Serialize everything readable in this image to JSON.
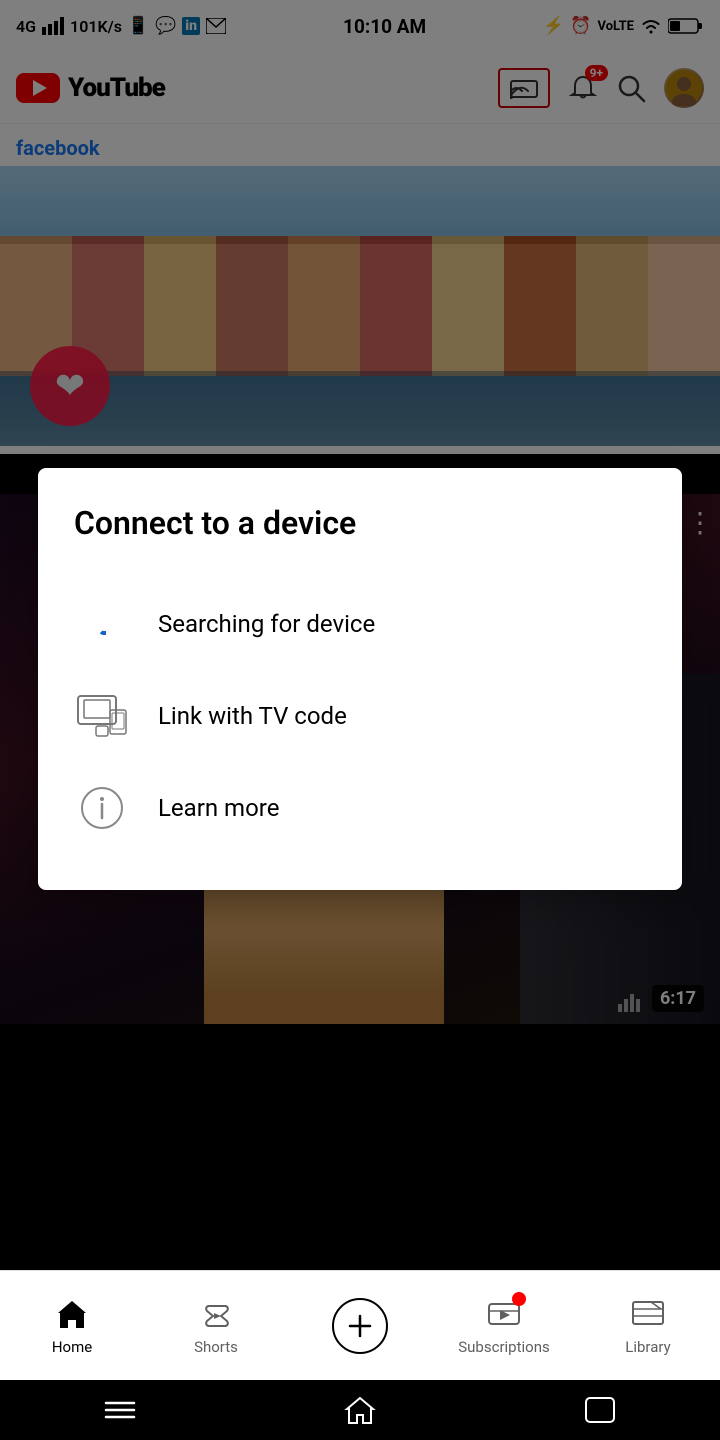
{
  "statusBar": {
    "signal": "4G",
    "bars": "▌▌▌",
    "speed": "101K/s",
    "time": "10:10 AM",
    "battery": "34"
  },
  "header": {
    "logoText": "YouTube",
    "castLabel": "cast-icon",
    "notifBadge": "9+",
    "searchLabel": "search-icon",
    "avatarLabel": "user-avatar"
  },
  "fbPost": {
    "source": "facebook",
    "label": "facebook"
  },
  "secondVideo": {
    "duration": "6:17"
  },
  "modal": {
    "title": "Connect to a device",
    "items": [
      {
        "id": "searching",
        "icon": "searching-icon",
        "label": "Searching for device"
      },
      {
        "id": "tv-code",
        "icon": "tv-code-icon",
        "label": "Link with TV code"
      },
      {
        "id": "learn-more",
        "icon": "info-icon",
        "label": "Learn more"
      }
    ]
  },
  "bottomNav": {
    "items": [
      {
        "id": "home",
        "label": "Home",
        "active": true
      },
      {
        "id": "shorts",
        "label": "Shorts",
        "active": false
      },
      {
        "id": "add",
        "label": "",
        "active": false
      },
      {
        "id": "subscriptions",
        "label": "Subscriptions",
        "active": false
      },
      {
        "id": "library",
        "label": "Library",
        "active": false
      }
    ]
  },
  "systemNav": {
    "menu": "☰",
    "home": "⌂",
    "back": "⬚"
  }
}
